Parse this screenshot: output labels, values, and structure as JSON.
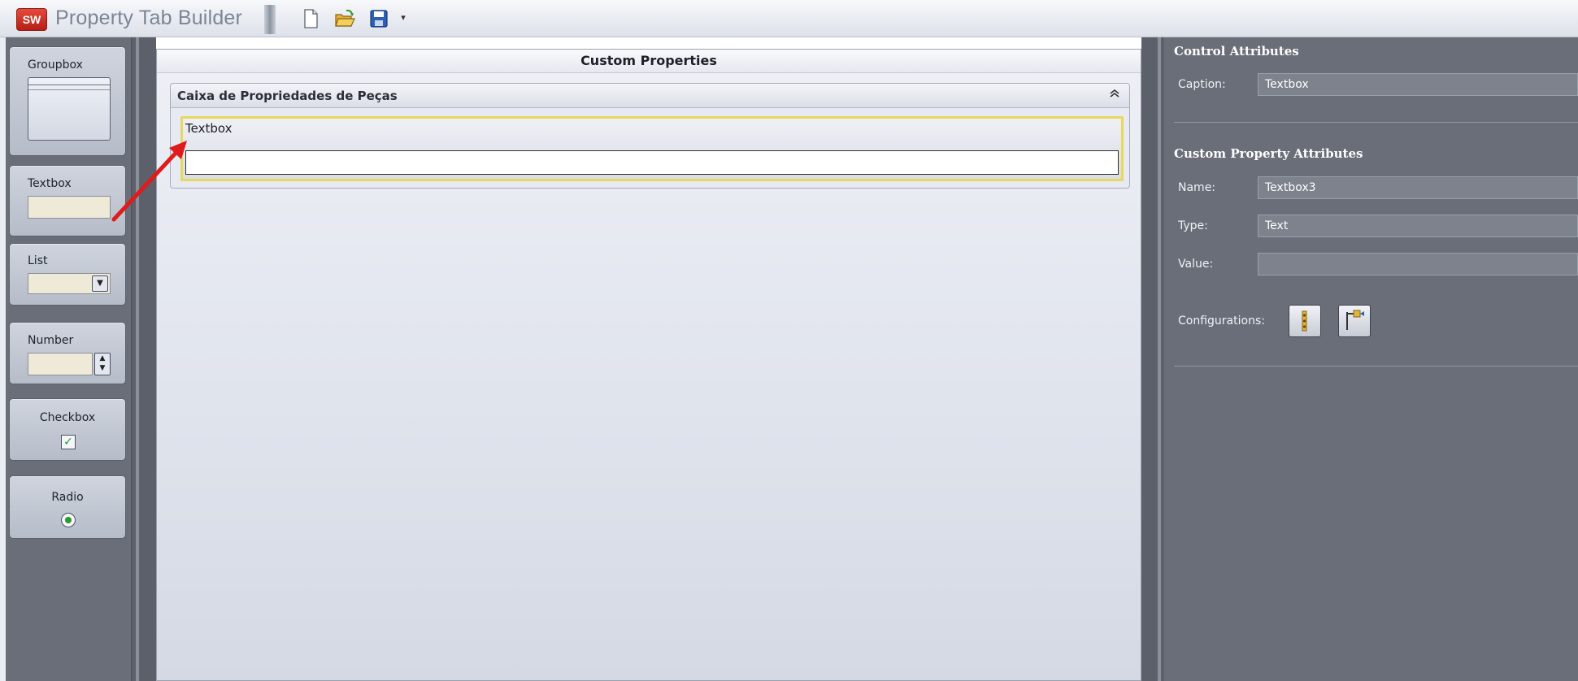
{
  "app": {
    "logo_text": "SW",
    "title": "Property Tab Builder"
  },
  "toolbar": {
    "icons": [
      "new-document-icon",
      "open-folder-icon",
      "save-icon",
      "dropdown-arrow-icon"
    ]
  },
  "toolbox": {
    "items": [
      {
        "label": "Groupbox"
      },
      {
        "label": "Textbox"
      },
      {
        "label": "List"
      },
      {
        "label": "Number"
      },
      {
        "label": "Checkbox"
      },
      {
        "label": "Radio"
      }
    ]
  },
  "canvas": {
    "header": "Custom Properties",
    "groupbox": {
      "title": "Caixa de Propriedades de Peças",
      "field_label": "Textbox",
      "field_value": ""
    }
  },
  "properties": {
    "control_section": "Control Attributes",
    "caption_label": "Caption:",
    "caption_value": "Textbox",
    "custom_section": "Custom Property Attributes",
    "name_label": "Name:",
    "name_value": "Textbox3",
    "type_label": "Type:",
    "type_value": "Text",
    "value_label": "Value:",
    "value_value": "",
    "config_label": "Configurations:"
  },
  "colors": {
    "panel_bg": "#6a6e79",
    "highlight_border": "#e6d95c",
    "arrow": "#e01b1b",
    "check_green": "#2a9a2a"
  }
}
